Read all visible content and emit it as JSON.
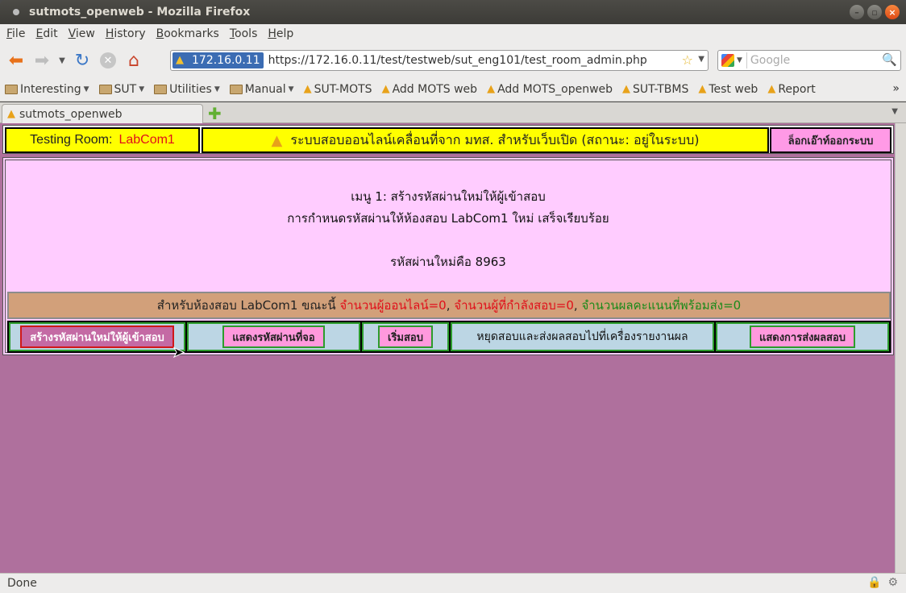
{
  "window": {
    "title": "sutmots_openweb - Mozilla Firefox"
  },
  "menu": [
    "File",
    "Edit",
    "View",
    "History",
    "Bookmarks",
    "Tools",
    "Help"
  ],
  "nav": {
    "identity": "172.16.0.11",
    "url": "https://172.16.0.11/test/testweb/sut_eng101/test_room_admin.php",
    "search_placeholder": "Google"
  },
  "bookmarks": [
    {
      "label": "Interesting",
      "type": "folder"
    },
    {
      "label": "SUT",
      "type": "folder"
    },
    {
      "label": "Utilities",
      "type": "folder"
    },
    {
      "label": "Manual",
      "type": "folder"
    },
    {
      "label": "SUT-MOTS",
      "type": "link"
    },
    {
      "label": "Add MOTS web",
      "type": "link"
    },
    {
      "label": "Add MOTS_openweb",
      "type": "link"
    },
    {
      "label": "SUT-TBMS",
      "type": "link"
    },
    {
      "label": "Test web",
      "type": "link"
    },
    {
      "label": "Report",
      "type": "link"
    }
  ],
  "tab": {
    "label": "sutmots_openweb"
  },
  "page": {
    "room_label": "Testing Room:",
    "room_name": "LabCom1",
    "system_title": "ระบบสอบออนไลน์เคลื่อนที่จาก มทส. สำหรับเว็บเปิด (สถานะ: อยู่ในระบบ)",
    "logout_label": "ล็อกเอ๊าท์ออกระบบ",
    "menu_line": "เมนู 1: สร้างรหัสผ่านใหม่ให้ผู้เข้าสอบ",
    "result_line": "การกำหนดรหัสผ่านให้ห้องสอบ LabCom1 ใหม่ เสร็จเรียบร้อย",
    "password_line": "รหัสผ่านใหม่คือ 8963",
    "status_prefix": "สำหรับห้องสอบ LabCom1 ขณะนี้ ",
    "status_online": "จำนวนผู้ออนไลน์=0",
    "status_sep": ", ",
    "status_testing": "จำนวนผู้ที่กำลังสอบ=0",
    "status_scores": "จำนวนผลคะแนนที่พร้อมส่ง=0",
    "buttons": {
      "create_password": "สร้างรหัสผ่านใหม่ให้ผู้เข้าสอบ",
      "show_password": "แสดงรหัสผ่านที่จอ",
      "start_exam": "เริ่มสอบ",
      "stop_exam": "หยุดสอบและส่งผลสอบไปที่เครื่องรายงานผล",
      "show_results": "แสดงการส่งผลสอบ"
    }
  },
  "status": {
    "text": "Done"
  },
  "colors": {
    "page_bg": "#af709d",
    "panel_bg": "#ffccff",
    "header_yellow": "#ffff00",
    "button_pink": "#ff99dd",
    "status_row": "#d2a07a"
  }
}
